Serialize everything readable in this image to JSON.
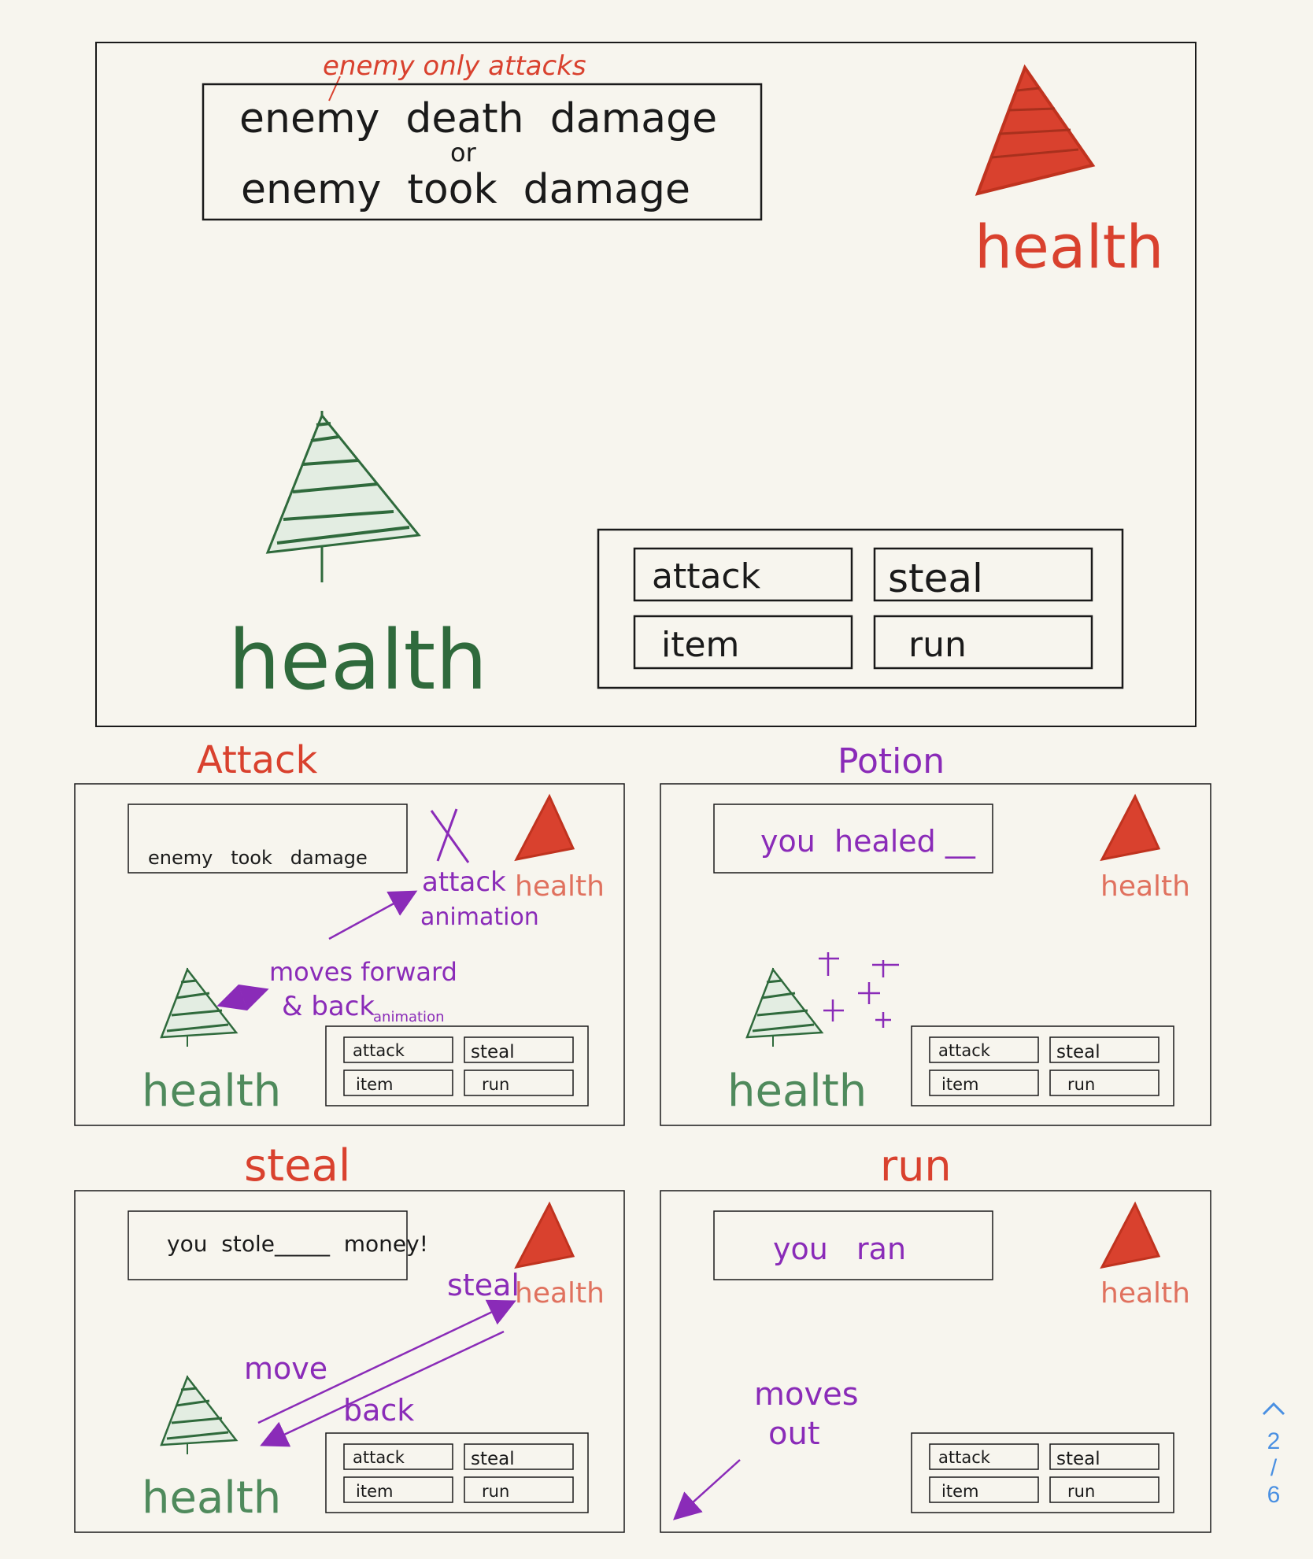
{
  "main_frame": {
    "annotation": "enemy only attacks",
    "message_line1": "enemy  death  damage",
    "message_or": "or",
    "message_line2": "enemy  took  damage",
    "enemy_health": "health",
    "player_health": "health",
    "menu": {
      "attack": "attack",
      "steal": "steal",
      "item": "item",
      "run": "run"
    }
  },
  "panels": {
    "attack": {
      "title": "Attack",
      "message": "enemy   took   damage",
      "enemy_health": "health",
      "player_health": "health",
      "note_attack": "attack",
      "note_animation": "animation",
      "note_moves": "moves forward",
      "note_back": "& back",
      "note_back_anim": "animation",
      "menu": {
        "attack": "attack",
        "steal": "steal",
        "item": "item",
        "run": "run"
      }
    },
    "potion": {
      "title": "Potion",
      "message": "you  healed __",
      "enemy_health": "health",
      "player_health": "health",
      "menu": {
        "attack": "attack",
        "steal": "steal",
        "item": "item",
        "run": "run"
      }
    },
    "steal": {
      "title": "steal",
      "message": "you  stole_____  money!",
      "enemy_health": "health",
      "player_health": "health",
      "note_steal": "steal",
      "note_move": "move",
      "note_back": "back",
      "menu": {
        "attack": "attack",
        "steal": "steal",
        "item": "item",
        "run": "run"
      }
    },
    "run": {
      "title": "run",
      "message": "you   ran",
      "enemy_health": "health",
      "note_moves": "moves",
      "note_out": "out",
      "menu": {
        "attack": "attack",
        "steal": "steal",
        "item": "item",
        "run": "run"
      }
    }
  },
  "pager": {
    "current": "2",
    "separator": "/",
    "total": "6",
    "icon": "chevron-up-icon"
  },
  "colors": {
    "ink": "#1a1a1a",
    "enemy": "#d9412e",
    "enemy_light": "#e0715e",
    "player": "#2f6a3c",
    "player_light": "#4f8a5c",
    "annotation": "#8a2bb8",
    "pager": "#4a90e2"
  }
}
